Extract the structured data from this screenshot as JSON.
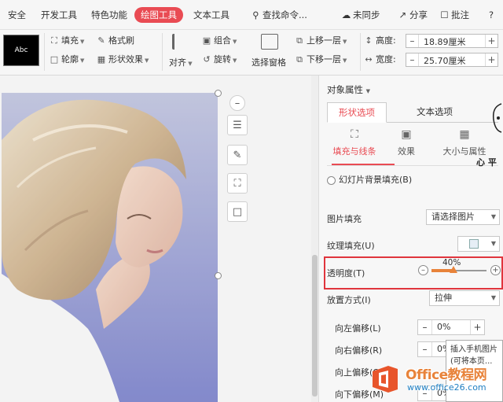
{
  "menu": {
    "items": [
      {
        "label": "安全"
      },
      {
        "label": "开发工具"
      },
      {
        "label": "特色功能"
      },
      {
        "label": "绘图工具"
      },
      {
        "label": "文本工具"
      },
      {
        "label": "查找命令..."
      },
      {
        "label": "未同步"
      },
      {
        "label": "分享"
      },
      {
        "label": "批注"
      },
      {
        "label": "?"
      }
    ]
  },
  "ribbon": {
    "style_preview": "Abc",
    "fill": "填充",
    "format_brush": "格式刷",
    "outline": "轮廓",
    "shape_effect": "形状效果",
    "align": "对齐",
    "group": "组合",
    "rotate": "旋转",
    "selection_pane": "选择窗格",
    "bring_forward": "上移一层",
    "send_backward": "下移一层",
    "height_label": "高度:",
    "height_value": "18.89厘米",
    "width_label": "宽度:",
    "width_value": "25.70厘米"
  },
  "pane": {
    "title": "对象属性",
    "tabs": [
      "形状选项",
      "文本选项"
    ],
    "subtabs": [
      "填充与线条",
      "效果",
      "大小与属性"
    ],
    "slide_bg_fill": "幻灯片背景填充(B)",
    "picture_fill_label": "图片填充",
    "picture_fill_value": "请选择图片",
    "texture_fill_label": "纹理填充(U)",
    "transparency_label": "透明度(T)",
    "transparency_value": "40%",
    "transparency_fraction": 0.4,
    "placement_label": "放置方式(I)",
    "placement_value": "拉伸",
    "offsets": [
      {
        "label": "向左偏移(L)",
        "value": "0%"
      },
      {
        "label": "向右偏移(R)",
        "value": "0%"
      },
      {
        "label": "向上偏移(O)",
        "value": ""
      },
      {
        "label": "向下偏移(M)",
        "value": "0%"
      }
    ],
    "tooltip_lines": [
      "插入手机图片",
      "(可将本页..."
    ]
  },
  "watermark": {
    "brand": "Office教程网",
    "url": "www.office26.com"
  },
  "sketch_text": "心 平",
  "colors": {
    "accent": "#e94b53",
    "slider": "#e8833a",
    "highlight": "#e0353d"
  }
}
